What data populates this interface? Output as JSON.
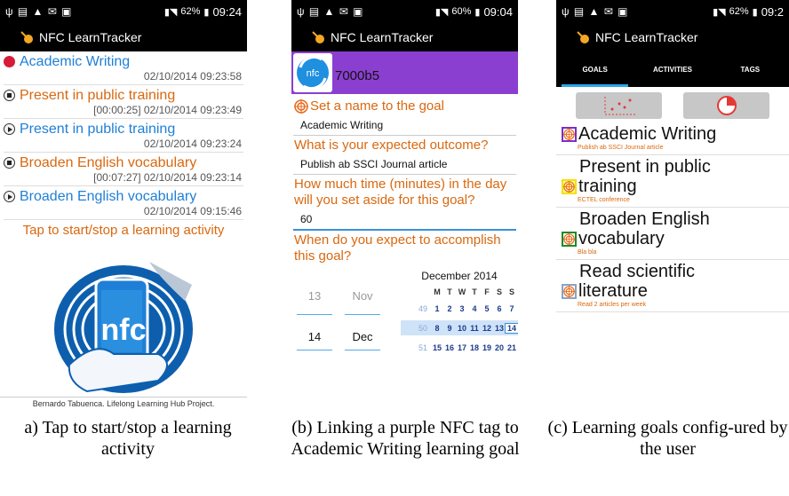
{
  "status": {
    "left_icons": "ψ ▤ ▲ ✉ ▣",
    "p1": {
      "battery": "62%",
      "time": "09:24"
    },
    "p2": {
      "battery": "60%",
      "time": "09:04"
    },
    "p3": {
      "battery": "62%",
      "time": "09:2"
    }
  },
  "app_title": "NFC LearnTracker",
  "panel1": {
    "activities": [
      {
        "name": "Academic Writing",
        "time": "02/10/2014 09:23:58",
        "state": "recording",
        "color": "#1f7fd6"
      },
      {
        "name": "Present in public training",
        "time": "[00:00:25] 02/10/2014 09:23:49",
        "state": "stop",
        "color": "#d9680f"
      },
      {
        "name": "Present in public training",
        "time": "02/10/2014 09:23:24",
        "state": "play",
        "color": "#1f7fd6"
      },
      {
        "name": "Broaden English vocabulary",
        "time": "[00:07:27] 02/10/2014 09:23:14",
        "state": "stop",
        "color": "#d9680f"
      },
      {
        "name": "Broaden English vocabulary",
        "time": "02/10/2014 09:15:46",
        "state": "play",
        "color": "#1f7fd6"
      }
    ],
    "tap_label": "Tap to start/stop a learning activity",
    "nfc_logo_text": "nfc",
    "credit": "Bernardo Tabuenca. Lifelong Learning Hub Project."
  },
  "panel2": {
    "tag_logo_text": "nfc",
    "tag_id": "7000b5",
    "tag_color": "#8b3fd0",
    "q_name": "Set a name to the goal",
    "a_name": "Academic Writing",
    "q_outcome": "What is your expected outcome?",
    "a_outcome": "Publish ab SSCI Journal article",
    "q_time": "How much time (minutes) in the day will you set aside for this goal?",
    "a_time": "60",
    "q_when": "When do you expect to accomplish this goal?",
    "wheel": {
      "day_prev": "13",
      "month_prev": "Nov",
      "day": "14",
      "month": "Dec"
    },
    "calendar": {
      "title": "December 2014",
      "weekdays": [
        "M",
        "T",
        "W",
        "T",
        "F",
        "S",
        "S"
      ],
      "weeks": [
        {
          "num": "49",
          "days": [
            "1",
            "2",
            "3",
            "4",
            "5",
            "6",
            "7"
          ]
        },
        {
          "num": "50",
          "days": [
            "8",
            "9",
            "10",
            "11",
            "12",
            "13",
            "14"
          ]
        },
        {
          "num": "51",
          "days": [
            "15",
            "16",
            "17",
            "18",
            "19",
            "20",
            "21"
          ]
        }
      ]
    }
  },
  "panel3": {
    "tabs": [
      "GOALS",
      "ACTIVITIES",
      "TAGS"
    ],
    "goals": [
      {
        "name1": "Academic Writing",
        "name2": "",
        "sub": "Publish ab SSCI Journal article",
        "tag_color": "#7b2fc9"
      },
      {
        "name1": "Present in public",
        "name2": "training",
        "sub": "ECTEL conference",
        "tag_color": "#f2e200"
      },
      {
        "name1": "Broaden English",
        "name2": "vocabulary",
        "sub": "Bla bla",
        "tag_color": "#1e8a2a"
      },
      {
        "name1": "Read scientific",
        "name2": "literature",
        "sub": "Read 2 articles per week",
        "tag_color": "#8aa4c6"
      }
    ]
  },
  "captions": {
    "c1": "a) Tap to start/stop a learning activity",
    "c2": "(b) Linking a purple NFC tag to Academic Writing learning goal",
    "c3": "(c) Learning goals config-ured by the user"
  }
}
